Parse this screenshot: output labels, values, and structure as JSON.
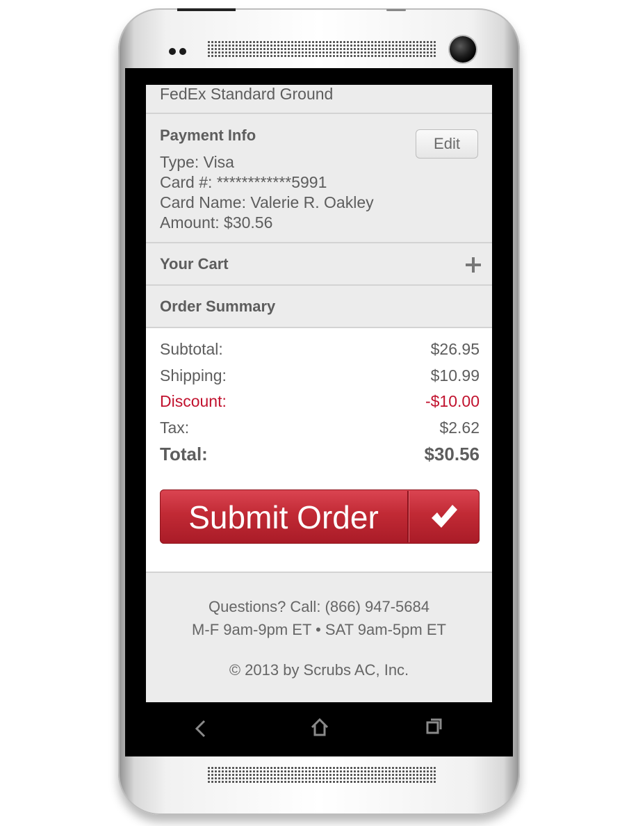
{
  "shipping": {
    "method": "FedEx Standard Ground"
  },
  "payment": {
    "heading": "Payment Info",
    "edit_label": "Edit",
    "type_line": "Type: Visa",
    "card_line": "Card #: ************5991",
    "name_line": "Card Name: Valerie R. Oakley",
    "amount_line": "Amount: $30.56"
  },
  "cart": {
    "heading": "Your Cart",
    "expand_icon": "plus-icon"
  },
  "summary": {
    "heading": "Order Summary",
    "rows": [
      {
        "label": "Subtotal:",
        "value": "$26.95"
      },
      {
        "label": "Shipping:",
        "value": "$10.99"
      },
      {
        "label": "Discount:",
        "value": "-$10.00"
      },
      {
        "label": "Tax:",
        "value": "$2.62"
      }
    ],
    "total_label": "Total:",
    "total_value": "$30.56"
  },
  "submit": {
    "label": "Submit Order",
    "icon": "checkmark-icon"
  },
  "footer": {
    "questions": "Questions? Call: (866) 947-5684",
    "hours": "M-F 9am-9pm ET • SAT 9am-5pm ET",
    "copyright": "© 2013 by Scrubs AC, Inc."
  },
  "nav": {
    "icons": [
      "back-icon",
      "home-icon",
      "recent-apps-icon"
    ]
  },
  "colors": {
    "accent": "#c1122e",
    "button": "#b8232f",
    "text": "#5d5d5d"
  }
}
